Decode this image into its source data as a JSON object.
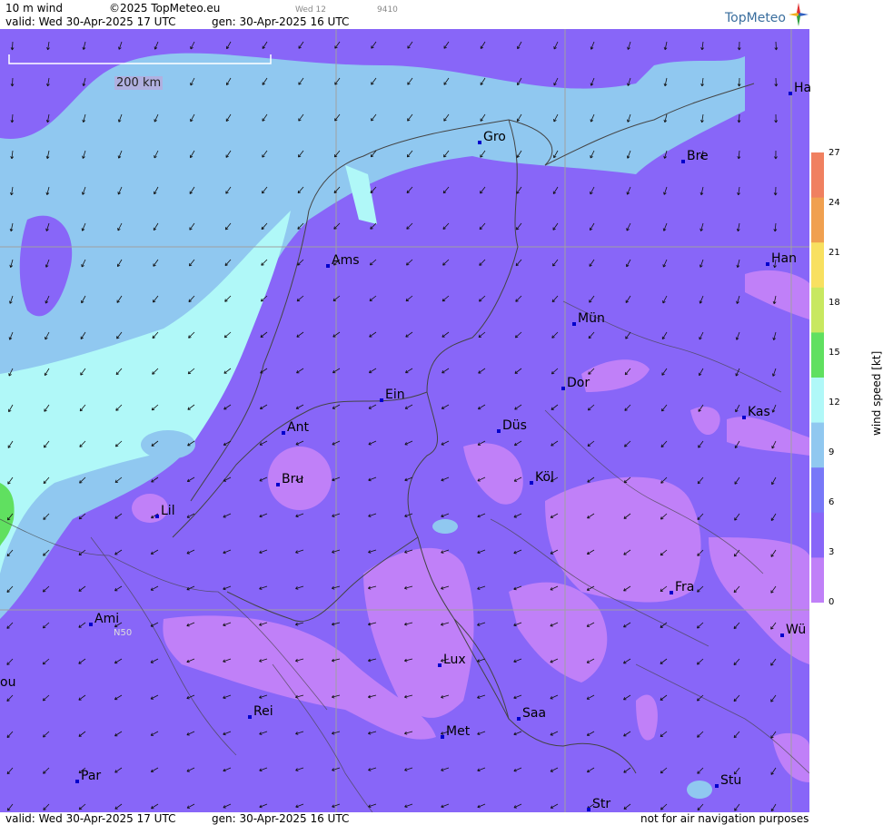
{
  "header": {
    "product": "10 m wind",
    "copyright": "©2025 TopMeteo.eu",
    "day_tag": "Wed 12",
    "code": "9410",
    "valid": "valid:  Wed  30-Apr-2025  17 UTC",
    "generated": "gen: 30-Apr-2025 16 UTC",
    "logo": "TopMeteo"
  },
  "footer": {
    "valid": "valid:  Wed  30-Apr-2025  17 UTC",
    "generated": "gen: 30-Apr-2025 16 UTC",
    "disclaimer": "not for air navigation purposes"
  },
  "map": {
    "scale_bar": "200 km",
    "latitude_label": "N50",
    "cities": [
      "Ha",
      "Gro",
      "Bre",
      "Ams",
      "Han",
      "Mün",
      "Ein",
      "Dor",
      "Kas",
      "Ant",
      "Düs",
      "Bru",
      "Köl",
      "Lil",
      "Fra",
      "Ami",
      "Wü",
      "Lux",
      "ou",
      "Rei",
      "Saa",
      "Met",
      "Par",
      "Stu",
      "Str"
    ]
  },
  "legend": {
    "title": "wind  speed  [kt]",
    "ticks": [
      "27",
      "24",
      "21",
      "18",
      "15",
      "12",
      "9",
      "6",
      "3",
      "0"
    ],
    "colors": [
      "#f08060",
      "#f0a050",
      "#f8e060",
      "#c8e860",
      "#60e060",
      "#b0f8f8",
      "#90c8f0",
      "#7878f8",
      "#8866f8",
      "#c080f8"
    ]
  },
  "colors": {
    "calm": "#c080f8",
    "light": "#8866f8",
    "moderate": "#90c8f0",
    "fresh": "#b0f8f8",
    "strong": "#60e060"
  }
}
